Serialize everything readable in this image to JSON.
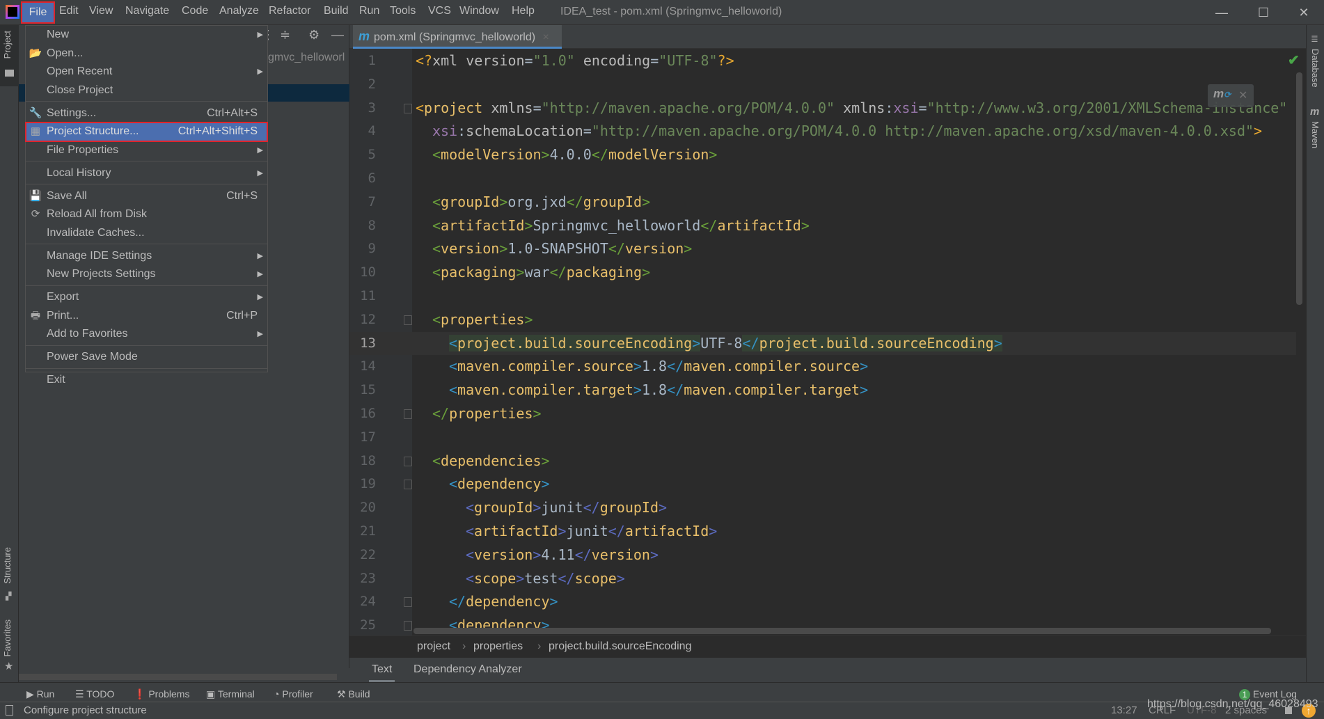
{
  "titlebar": {
    "menus": [
      "File",
      "Edit",
      "View",
      "Navigate",
      "Code",
      "Analyze",
      "Refactor",
      "Build",
      "Run",
      "Tools",
      "VCS",
      "Window",
      "Help"
    ],
    "title": "IDEA_test - pom.xml (Springmvc_helloworld)",
    "minimize": "—",
    "maximize": "☐",
    "close": "✕"
  },
  "left_strip": {
    "project": "Project",
    "structure": "Structure",
    "favorites": "Favorites"
  },
  "project_panel": {
    "visible_text": "gmvc_helloworl"
  },
  "tab": {
    "icon": "m",
    "label": "pom.xml (Springmvc_helloworld)",
    "close": "×"
  },
  "right_strip": {
    "database": "Database",
    "maven": "Maven"
  },
  "file_menu": {
    "items": [
      {
        "label": "New",
        "submenu": true
      },
      {
        "label": "Open...",
        "icon": "folder-open-icon",
        "glyph": "📂"
      },
      {
        "label": "Open Recent",
        "submenu": true
      },
      {
        "label": "Close Project",
        "sep": true
      },
      {
        "label": "Settings...",
        "shortcut": "Ctrl+Alt+S",
        "icon": "wrench-icon",
        "glyph": "🔧"
      },
      {
        "label": "Project Structure...",
        "shortcut": "Ctrl+Alt+Shift+S",
        "icon": "project-structure-icon",
        "glyph": "▦",
        "selected": true
      },
      {
        "label": "File Properties",
        "submenu": true,
        "sep": true
      },
      {
        "label": "Local History",
        "submenu": true,
        "sep": true
      },
      {
        "label": "Save All",
        "shortcut": "Ctrl+S",
        "icon": "save-icon",
        "glyph": "💾"
      },
      {
        "label": "Reload All from Disk",
        "icon": "reload-icon",
        "glyph": "⟳"
      },
      {
        "label": "Invalidate Caches...",
        "sep": true
      },
      {
        "label": "Manage IDE Settings",
        "submenu": true
      },
      {
        "label": "New Projects Settings",
        "submenu": true,
        "sep": true
      },
      {
        "label": "Export",
        "submenu": true
      },
      {
        "label": "Print...",
        "shortcut": "Ctrl+P",
        "icon": "print-icon",
        "glyph": "🖶"
      },
      {
        "label": "Add to Favorites",
        "submenu": true,
        "sep": true
      },
      {
        "label": "Power Save Mode",
        "sep": true
      },
      {
        "label": "Exit"
      }
    ]
  },
  "editor": {
    "current_line": 13,
    "lines": [
      {
        "n": 1,
        "i": 0,
        "t": [
          [
            "b0",
            "<?"
          ],
          [
            "attr",
            "xml version"
          ],
          [
            "eq",
            "="
          ],
          [
            "str",
            "\"1.0\""
          ],
          [
            "attr",
            " encoding"
          ],
          [
            "eq",
            "="
          ],
          [
            "str",
            "\"UTF-8\""
          ],
          [
            "b0",
            "?>"
          ]
        ]
      },
      {
        "n": 2,
        "i": 0,
        "t": []
      },
      {
        "n": 3,
        "i": 0,
        "fold": true,
        "t": [
          [
            "b0",
            "<"
          ],
          [
            "tag",
            "project"
          ],
          [
            "attr",
            " xmlns"
          ],
          [
            "eq",
            "="
          ],
          [
            "str",
            "\"http://maven.apache.org/POM/4.0.0\""
          ],
          [
            "attr",
            " xmlns"
          ],
          [
            "eq",
            ":"
          ],
          [
            "ns",
            "xsi"
          ],
          [
            "eq",
            "="
          ],
          [
            "str",
            "\"http://www.w3.org/2001/XMLSchema-instance\""
          ]
        ]
      },
      {
        "n": 4,
        "i": 1,
        "t": [
          [
            "ns",
            "xsi"
          ],
          [
            "eq",
            ":"
          ],
          [
            "attr",
            "schemaLocation"
          ],
          [
            "eq",
            "="
          ],
          [
            "str",
            "\"http://maven.apache.org/POM/4.0.0 http://maven.apache.org/xsd/maven-4.0.0.xsd\""
          ],
          [
            "b0",
            ">"
          ]
        ]
      },
      {
        "n": 5,
        "i": 1,
        "t": [
          [
            "b1",
            "<"
          ],
          [
            "tag",
            "modelVersion"
          ],
          [
            "b1",
            ">"
          ],
          [
            "txt",
            "4.0.0"
          ],
          [
            "b1",
            "</"
          ],
          [
            "tag",
            "modelVersion"
          ],
          [
            "b1",
            ">"
          ]
        ]
      },
      {
        "n": 6,
        "i": 0,
        "t": []
      },
      {
        "n": 7,
        "i": 1,
        "t": [
          [
            "b1",
            "<"
          ],
          [
            "tag",
            "groupId"
          ],
          [
            "b1",
            ">"
          ],
          [
            "txt",
            "org.jxd"
          ],
          [
            "b1",
            "</"
          ],
          [
            "tag",
            "groupId"
          ],
          [
            "b1",
            ">"
          ]
        ]
      },
      {
        "n": 8,
        "i": 1,
        "t": [
          [
            "b1",
            "<"
          ],
          [
            "tag",
            "artifactId"
          ],
          [
            "b1",
            ">"
          ],
          [
            "txt",
            "Springmvc_helloworld"
          ],
          [
            "b1",
            "</"
          ],
          [
            "tag",
            "artifactId"
          ],
          [
            "b1",
            ">"
          ]
        ]
      },
      {
        "n": 9,
        "i": 1,
        "t": [
          [
            "b1",
            "<"
          ],
          [
            "tag",
            "version"
          ],
          [
            "b1",
            ">"
          ],
          [
            "txt",
            "1.0-SNAPSHOT"
          ],
          [
            "b1",
            "</"
          ],
          [
            "tag",
            "version"
          ],
          [
            "b1",
            ">"
          ]
        ]
      },
      {
        "n": 10,
        "i": 1,
        "t": [
          [
            "b1",
            "<"
          ],
          [
            "tag",
            "packaging"
          ],
          [
            "b1",
            ">"
          ],
          [
            "txt",
            "war"
          ],
          [
            "b1",
            "</"
          ],
          [
            "tag",
            "packaging"
          ],
          [
            "b1",
            ">"
          ]
        ]
      },
      {
        "n": 11,
        "i": 0,
        "t": []
      },
      {
        "n": 12,
        "i": 1,
        "fold": true,
        "t": [
          [
            "b1",
            "<"
          ],
          [
            "tag",
            "properties"
          ],
          [
            "b1",
            ">"
          ]
        ]
      },
      {
        "n": 13,
        "i": 2,
        "t": [
          [
            "b2 hl",
            "<"
          ],
          [
            "tag hl",
            "project.build.sourceEncoding"
          ],
          [
            "b2 hl",
            ">"
          ],
          [
            "txt",
            "UTF-8"
          ],
          [
            "b2 hl",
            "</"
          ],
          [
            "tag hl",
            "project.build.sourceEncoding"
          ],
          [
            "b2 hl",
            ">"
          ]
        ]
      },
      {
        "n": 14,
        "i": 2,
        "t": [
          [
            "b2",
            "<"
          ],
          [
            "tag",
            "maven.compiler.source"
          ],
          [
            "b2",
            ">"
          ],
          [
            "txt",
            "1.8"
          ],
          [
            "b2",
            "</"
          ],
          [
            "tag",
            "maven.compiler.source"
          ],
          [
            "b2",
            ">"
          ]
        ]
      },
      {
        "n": 15,
        "i": 2,
        "t": [
          [
            "b2",
            "<"
          ],
          [
            "tag",
            "maven.compiler.target"
          ],
          [
            "b2",
            ">"
          ],
          [
            "txt",
            "1.8"
          ],
          [
            "b2",
            "</"
          ],
          [
            "tag",
            "maven.compiler.target"
          ],
          [
            "b2",
            ">"
          ]
        ]
      },
      {
        "n": 16,
        "i": 1,
        "fold": true,
        "t": [
          [
            "b1",
            "</"
          ],
          [
            "tag",
            "properties"
          ],
          [
            "b1",
            ">"
          ]
        ]
      },
      {
        "n": 17,
        "i": 0,
        "t": []
      },
      {
        "n": 18,
        "i": 1,
        "fold": true,
        "t": [
          [
            "b1",
            "<"
          ],
          [
            "tag",
            "dependencies"
          ],
          [
            "b1",
            ">"
          ]
        ]
      },
      {
        "n": 19,
        "i": 2,
        "fold": true,
        "t": [
          [
            "b2",
            "<"
          ],
          [
            "tag",
            "dependency"
          ],
          [
            "b2",
            ">"
          ]
        ]
      },
      {
        "n": 20,
        "i": 3,
        "t": [
          [
            "b3",
            "<"
          ],
          [
            "tag",
            "groupId"
          ],
          [
            "b3",
            ">"
          ],
          [
            "txt",
            "junit"
          ],
          [
            "b3",
            "</"
          ],
          [
            "tag",
            "groupId"
          ],
          [
            "b3",
            ">"
          ]
        ]
      },
      {
        "n": 21,
        "i": 3,
        "t": [
          [
            "b3",
            "<"
          ],
          [
            "tag",
            "artifactId"
          ],
          [
            "b3",
            ">"
          ],
          [
            "txt",
            "junit"
          ],
          [
            "b3",
            "</"
          ],
          [
            "tag",
            "artifactId"
          ],
          [
            "b3",
            ">"
          ]
        ]
      },
      {
        "n": 22,
        "i": 3,
        "t": [
          [
            "b3",
            "<"
          ],
          [
            "tag",
            "version"
          ],
          [
            "b3",
            ">"
          ],
          [
            "txt",
            "4.11"
          ],
          [
            "b3",
            "</"
          ],
          [
            "tag",
            "version"
          ],
          [
            "b3",
            ">"
          ]
        ]
      },
      {
        "n": 23,
        "i": 3,
        "t": [
          [
            "b3",
            "<"
          ],
          [
            "tag",
            "scope"
          ],
          [
            "b3",
            ">"
          ],
          [
            "txt",
            "test"
          ],
          [
            "b3",
            "</"
          ],
          [
            "tag",
            "scope"
          ],
          [
            "b3",
            ">"
          ]
        ]
      },
      {
        "n": 24,
        "i": 2,
        "fold": true,
        "t": [
          [
            "b2",
            "</"
          ],
          [
            "tag",
            "dependency"
          ],
          [
            "b2",
            ">"
          ]
        ]
      },
      {
        "n": 25,
        "i": 2,
        "fold": true,
        "t": [
          [
            "b2",
            "<"
          ],
          [
            "tag",
            "dependency"
          ],
          [
            "b2",
            ">"
          ]
        ]
      }
    ]
  },
  "breadcrumbs": [
    "project",
    "properties",
    "project.build.sourceEncoding"
  ],
  "bottom_tabs": {
    "text": "Text",
    "dependency_analyzer": "Dependency Analyzer"
  },
  "tool_windows": [
    "Run",
    "TODO",
    "Problems",
    "Terminal",
    "Profiler",
    "Build"
  ],
  "event_log": {
    "count": "1",
    "label": "Event Log"
  },
  "status": {
    "message": "Configure project structure",
    "position": "13:27",
    "line_sep": "CRLF",
    "encoding": "UTF-8",
    "indent": "2 spaces",
    "watermark": "https://blog.csdn.net/qq_46028493"
  },
  "colors": {
    "selection": "#4b6eaf",
    "highlight_box": "#e0242b",
    "editor_bg": "#2b2b2b",
    "tag": "#e8bf6a",
    "string": "#6a8759"
  }
}
